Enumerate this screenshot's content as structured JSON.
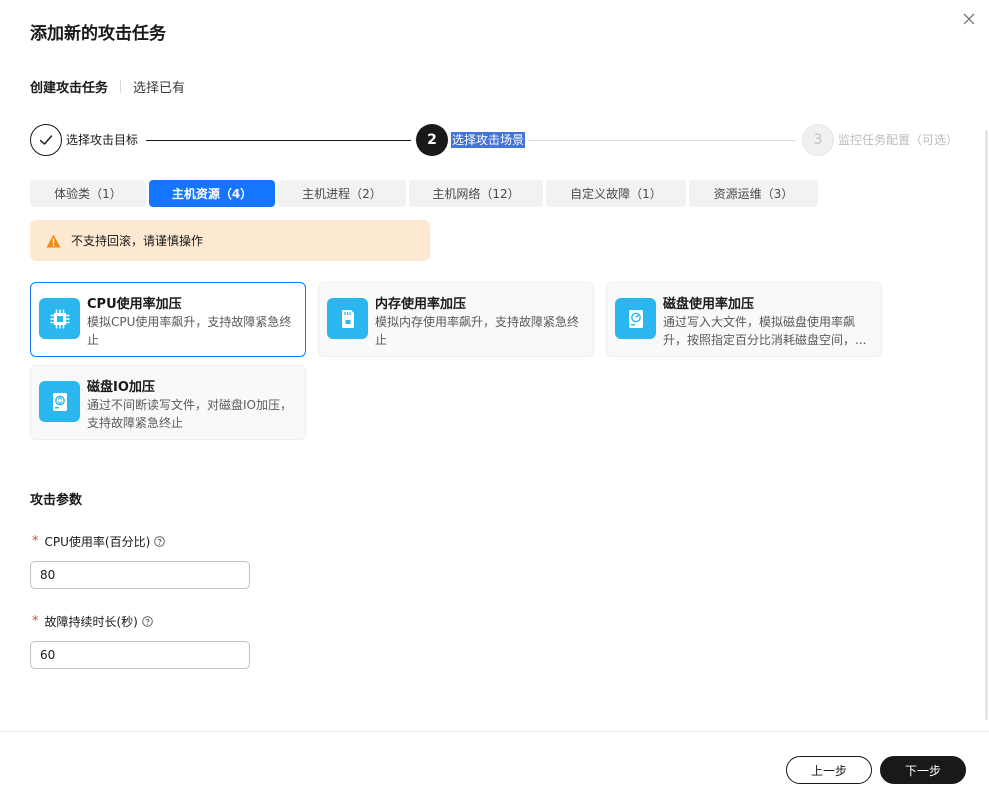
{
  "dialog": {
    "title": "添加新的攻击任务"
  },
  "mode_switch": {
    "create_label": "创建攻击任务",
    "choose_label": "选择已有"
  },
  "stepper": {
    "step1": {
      "label": "选择攻击目标",
      "state": "done"
    },
    "step2": {
      "number": "2",
      "label": "选择攻击场景",
      "state": "active"
    },
    "step3": {
      "number": "3",
      "label": "监控任务配置（可选）",
      "state": "pending"
    }
  },
  "tabs": [
    {
      "label": "体验类（1）",
      "active": false
    },
    {
      "label": "主机资源（4）",
      "active": true
    },
    {
      "label": "主机进程（2）",
      "active": false
    },
    {
      "label": "主机网络（12）",
      "active": false
    },
    {
      "label": "自定义故障（1）",
      "active": false
    },
    {
      "label": "资源运维（3）",
      "active": false
    }
  ],
  "warning": {
    "text": "不支持回滚，请谨慎操作"
  },
  "cards": [
    {
      "title": "CPU使用率加压",
      "desc": "模拟CPU使用率飙升，支持故障紧急终止",
      "icon": "cpu-icon",
      "selected": true
    },
    {
      "title": "内存使用率加压",
      "desc": "模拟内存使用率飙升，支持故障紧急终止",
      "icon": "memory-icon",
      "selected": false
    },
    {
      "title": "磁盘使用率加压",
      "desc": "通过写入大文件，模拟磁盘使用率飙升，按照指定百分比消耗磁盘空间，...",
      "icon": "disk-icon",
      "selected": false
    },
    {
      "title": "磁盘IO加压",
      "desc": "通过不间断读写文件，对磁盘IO加压，支持故障紧急终止",
      "icon": "disk-io-icon",
      "selected": false
    }
  ],
  "params": {
    "section_title": "攻击参数",
    "cpu": {
      "required_mark": "*",
      "label": "CPU使用率(百分比)",
      "value": "80"
    },
    "duration": {
      "required_mark": "*",
      "label": "故障持续时长(秒)",
      "value": "60"
    }
  },
  "footer": {
    "prev_label": "上一步",
    "next_label": "下一步"
  },
  "colors": {
    "primary": "#1476ff",
    "dark": "#191919",
    "warning_bg": "#fde9d1",
    "warning_icon": "#f08c1a",
    "card_icon_bg": "#2ab7f0",
    "required": "#e54545"
  }
}
